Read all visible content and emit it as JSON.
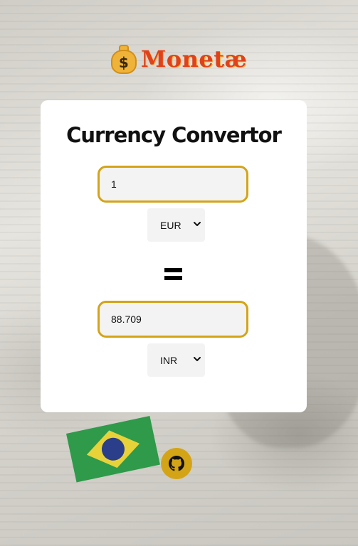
{
  "brand": {
    "name": "Monetæ",
    "icon": "money-bag-icon",
    "icon_glyph": "$",
    "color": "#e0411a"
  },
  "converter": {
    "title": "Currency Convertor",
    "from": {
      "amount": "1",
      "currency": "EUR"
    },
    "equals_symbol": "=",
    "to": {
      "amount": "88.709",
      "currency": "INR"
    },
    "accent_color": "#d4a417"
  },
  "footer": {
    "github_icon": "github-icon"
  }
}
